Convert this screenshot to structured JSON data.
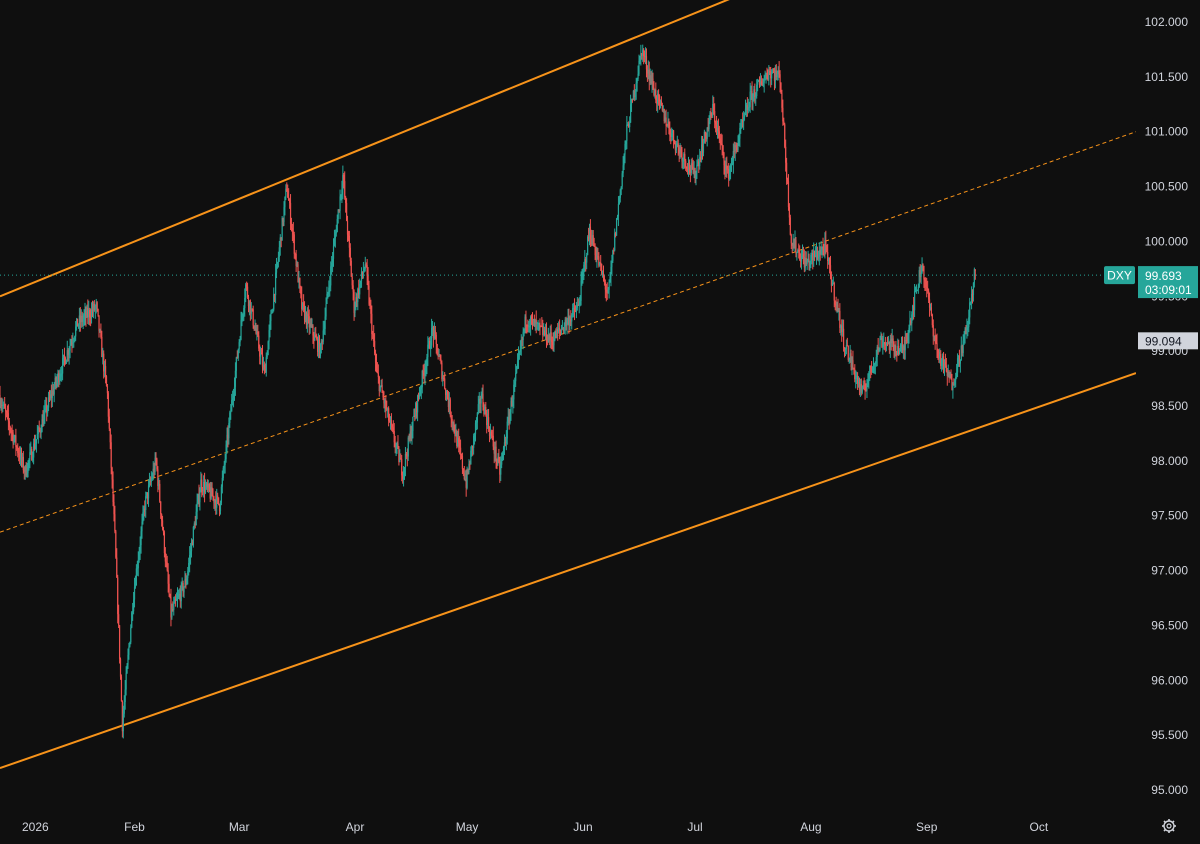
{
  "chart_data": {
    "type": "candlestick",
    "symbol": "DXY",
    "last_price": "99.693",
    "countdown": "03:09:01",
    "marker_price": "99.094",
    "y_ticks": [
      "102.000",
      "101.500",
      "101.000",
      "100.500",
      "100.000",
      "99.500",
      "99.000",
      "98.500",
      "98.000",
      "97.500",
      "97.000",
      "96.500",
      "96.000",
      "95.500",
      "95.000"
    ],
    "ylim": [
      94.8,
      102.2
    ],
    "x_ticks": [
      "2026",
      "Feb",
      "Mar",
      "Apr",
      "May",
      "Jun",
      "Jul",
      "Aug",
      "Sep",
      "Oct"
    ],
    "x_tick_dates": [
      "2026-01-01",
      "2026-02-01",
      "2026-03-01",
      "2026-04-01",
      "2026-05-01",
      "2026-06-01",
      "2026-07-01",
      "2026-08-01",
      "2026-09-01",
      "2026-10-01"
    ],
    "date_range": [
      "2025-12-27",
      "2026-10-27"
    ],
    "price_path": [
      [
        "2025-12-27",
        98.6
      ],
      [
        "2026-01-03",
        97.9
      ],
      [
        "2026-01-10",
        98.6
      ],
      [
        "2026-01-17",
        99.25
      ],
      [
        "2026-01-22",
        99.4
      ],
      [
        "2026-01-25",
        98.6
      ],
      [
        "2026-01-27",
        97.3
      ],
      [
        "2026-01-29",
        95.6
      ],
      [
        "2026-02-01",
        96.8
      ],
      [
        "2026-02-04",
        97.6
      ],
      [
        "2026-02-07",
        98.0
      ],
      [
        "2026-02-11",
        96.6
      ],
      [
        "2026-02-15",
        96.9
      ],
      [
        "2026-02-19",
        97.8
      ],
      [
        "2026-02-24",
        97.6
      ],
      [
        "2026-03-03",
        99.6
      ],
      [
        "2026-03-08",
        98.8
      ],
      [
        "2026-03-14",
        100.5
      ],
      [
        "2026-03-18",
        99.4
      ],
      [
        "2026-03-23",
        99.0
      ],
      [
        "2026-03-29",
        100.6
      ],
      [
        "2026-04-01",
        99.4
      ],
      [
        "2026-04-04",
        99.8
      ],
      [
        "2026-04-07",
        98.8
      ],
      [
        "2026-04-14",
        97.9
      ],
      [
        "2026-04-22",
        99.2
      ],
      [
        "2026-05-01",
        97.8
      ],
      [
        "2026-05-05",
        98.6
      ],
      [
        "2026-05-10",
        97.9
      ],
      [
        "2026-05-17",
        99.3
      ],
      [
        "2026-05-24",
        99.1
      ],
      [
        "2026-05-31",
        99.4
      ],
      [
        "2026-06-03",
        100.1
      ],
      [
        "2026-06-08",
        99.5
      ],
      [
        "2026-06-13",
        101.0
      ],
      [
        "2026-06-17",
        101.75
      ],
      [
        "2026-06-21",
        101.3
      ],
      [
        "2026-06-26",
        100.9
      ],
      [
        "2026-07-01",
        100.6
      ],
      [
        "2026-07-06",
        101.2
      ],
      [
        "2026-07-10",
        100.6
      ],
      [
        "2026-07-16",
        101.3
      ],
      [
        "2026-07-21",
        101.55
      ],
      [
        "2026-07-24",
        101.5
      ],
      [
        "2026-07-27",
        100.0
      ],
      [
        "2026-07-31",
        99.8
      ],
      [
        "2026-08-05",
        99.95
      ],
      [
        "2026-08-10",
        99.1
      ],
      [
        "2026-08-15",
        98.6
      ],
      [
        "2026-08-20",
        99.1
      ],
      [
        "2026-08-26",
        99.0
      ],
      [
        "2026-08-31",
        99.8
      ],
      [
        "2026-09-04",
        99.0
      ],
      [
        "2026-09-08",
        98.7
      ],
      [
        "2026-09-12",
        99.2
      ],
      [
        "2026-09-14",
        99.69
      ]
    ],
    "channel_upper": [
      [
        "2025-12-27",
        99.5
      ],
      [
        "2026-07-24",
        102.4
      ]
    ],
    "channel_lower": [
      [
        "2025-12-27",
        95.2
      ],
      [
        "2026-10-27",
        98.8
      ]
    ],
    "channel_mid": [
      [
        "2025-12-27",
        97.35
      ],
      [
        "2026-10-27",
        101.0
      ]
    ],
    "colors": {
      "background": "#0f0f0f",
      "up": "#26a69a",
      "down": "#ef5350",
      "channel": "#f7931a",
      "last_price_line": "#26a69a",
      "label_bg_gray": "#d1d4dc",
      "axis_text": "#d1d4dc"
    }
  },
  "icons": {
    "settings": "gear-icon"
  }
}
